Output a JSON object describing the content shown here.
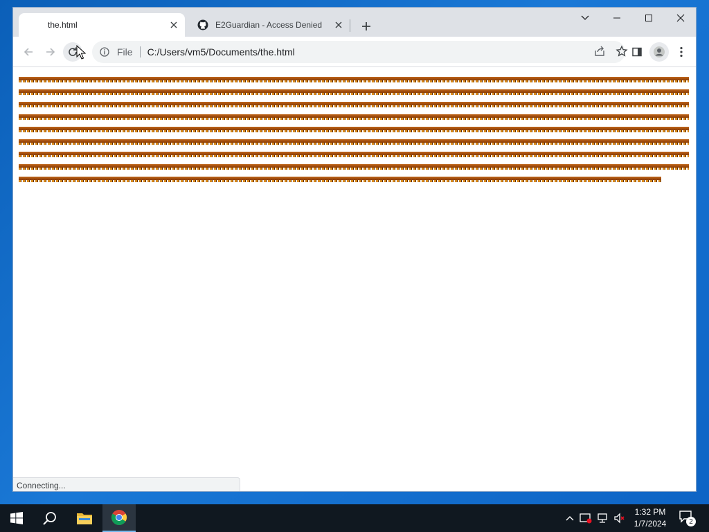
{
  "browser": {
    "tabs": [
      {
        "title": "the.html",
        "active": true
      },
      {
        "title": "E2Guardian - Access Denied",
        "active": false
      }
    ],
    "omnibox": {
      "scheme_label": "File",
      "url": "C:/Users/vm5/Documents/the.html"
    },
    "status_text": "Connecting..."
  },
  "page": {
    "image_row_count": 9
  },
  "taskbar": {
    "apps": [
      "start-icon",
      "search-icon",
      "file-explorer-icon",
      "chrome-icon"
    ],
    "clock": {
      "time": "1:32 PM",
      "date": "1/7/2024"
    },
    "notification_count": "2"
  },
  "colors": {
    "tabstrip": "#dee1e6",
    "omnibox": "#f1f3f4",
    "taskbar": "#101820",
    "desktop": "#1a78d6",
    "image_brown": "#8a3c05",
    "image_orange": "#d98a1a"
  }
}
